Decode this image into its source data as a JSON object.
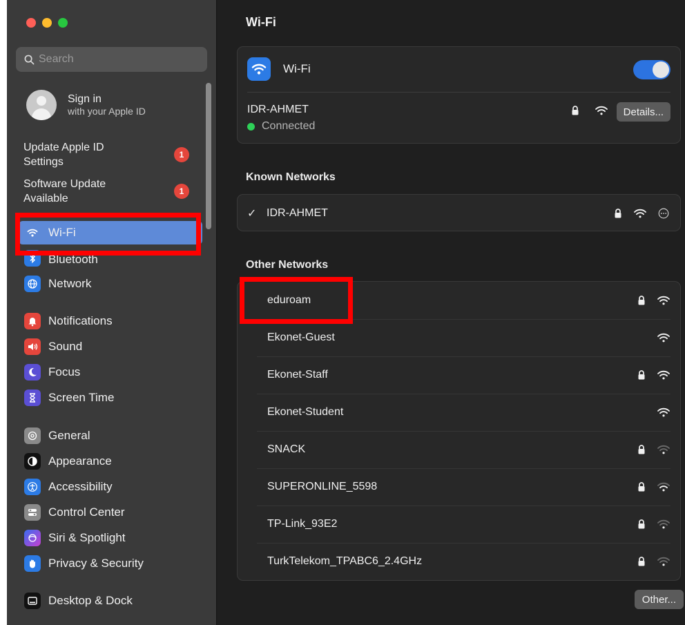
{
  "sidebar": {
    "search_placeholder": "Search",
    "signin": {
      "title": "Sign in",
      "subtitle": "with your Apple ID"
    },
    "updates": [
      {
        "label": "Update Apple ID Settings",
        "badge": "1"
      },
      {
        "label": "Software Update Available",
        "badge": "1"
      }
    ],
    "items": [
      {
        "label": "Wi-Fi",
        "icon": "wifi-icon",
        "color": "#5e8ad8",
        "selected": true
      },
      {
        "label": "Bluetooth",
        "icon": "bluetooth-icon",
        "color": "#2c7be5"
      },
      {
        "label": "Network",
        "icon": "globe-icon",
        "color": "#2c7be5"
      },
      {
        "label": "Notifications",
        "icon": "bell-icon",
        "color": "#e5463c"
      },
      {
        "label": "Sound",
        "icon": "speaker-icon",
        "color": "#e5463c"
      },
      {
        "label": "Focus",
        "icon": "moon-icon",
        "color": "#5b4fd4"
      },
      {
        "label": "Screen Time",
        "icon": "hourglass-icon",
        "color": "#5b4fd4"
      },
      {
        "label": "General",
        "icon": "gear-icon",
        "color": "#8a8a8a"
      },
      {
        "label": "Appearance",
        "icon": "appearance-icon",
        "color": "#111111"
      },
      {
        "label": "Accessibility",
        "icon": "accessibility-icon",
        "color": "#2c7be5"
      },
      {
        "label": "Control Center",
        "icon": "control-center-icon",
        "color": "#8a8a8a"
      },
      {
        "label": "Siri & Spotlight",
        "icon": "siri-icon",
        "color": "#7a3fc0"
      },
      {
        "label": "Privacy & Security",
        "icon": "hand-icon",
        "color": "#2c7be5"
      },
      {
        "label": "Desktop & Dock",
        "icon": "dock-icon",
        "color": "#111111"
      }
    ]
  },
  "main": {
    "title": "Wi-Fi",
    "wifi": {
      "label": "Wi-Fi",
      "enabled": true,
      "current_network": "IDR-AHMET",
      "status": "Connected",
      "details_label": "Details..."
    },
    "known_title": "Known Networks",
    "known_networks": [
      {
        "check": "✓",
        "name": "IDR-AHMET",
        "locked": true
      }
    ],
    "other_title": "Other Networks",
    "other_networks": [
      {
        "name": "eduroam",
        "locked": true,
        "signal": "strong"
      },
      {
        "name": "Ekonet-Guest",
        "locked": false,
        "signal": "strong"
      },
      {
        "name": "Ekonet-Staff",
        "locked": true,
        "signal": "strong"
      },
      {
        "name": "Ekonet-Student",
        "locked": false,
        "signal": "strong"
      },
      {
        "name": "SNACK",
        "locked": true,
        "signal": "weak"
      },
      {
        "name": "SUPERONLINE_5598",
        "locked": true,
        "signal": "medium"
      },
      {
        "name": "TP-Link_93E2",
        "locked": true,
        "signal": "weak"
      },
      {
        "name": "TurkTelekom_TPABC6_2.4GHz",
        "locked": true,
        "signal": "weak"
      }
    ],
    "other_button": "Other..."
  }
}
